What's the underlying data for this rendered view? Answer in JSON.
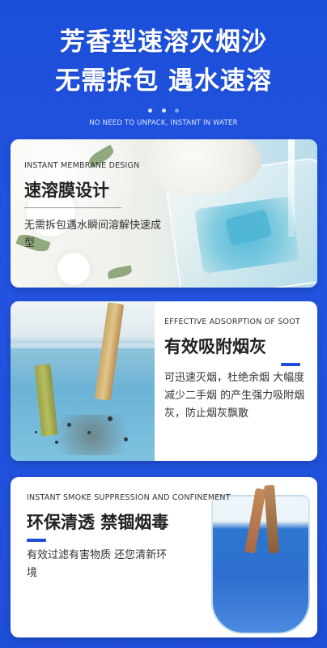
{
  "header": {
    "title_line1": "芳香型速溶灭烟沙",
    "title_line2": "无需拆包 遇水速溶",
    "subtitle": "NO NEED TO UNPACK, INSTANT IN WATER"
  },
  "cards": [
    {
      "en": "INSTANT MEMBRANE DESIGN",
      "cn_title": "速溶膜设计",
      "desc": "无需拆包遇水瞬间溶解快速成型"
    },
    {
      "en": "EFFECTIVE ADSORPTION OF SOOT",
      "cn_title": "有效吸附烟灰",
      "desc": "可迅速灭烟，杜绝余烟 大幅度减少二手烟 的产生强力吸附烟灰，防止烟灰飘散"
    },
    {
      "en": "INSTANT SMOKE SUPPRESSION AND CONFINEMENT",
      "cn_title": "环保清透 禁锢烟毒",
      "desc": "有效过滤有害物质 还您清新环境"
    }
  ],
  "colors": {
    "background": "#1f4fd8",
    "accent": "#1f4fd8",
    "title": "#ffffff"
  }
}
